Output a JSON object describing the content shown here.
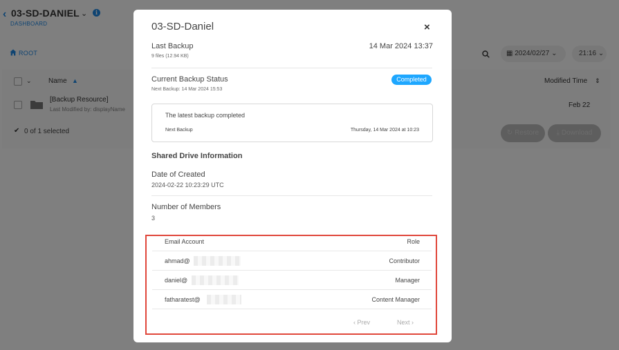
{
  "app": {
    "title": "03-SD-DANIEL",
    "subtitle": "DASHBOARD",
    "root_label": "ROOT",
    "date_filter": "2024/02/27",
    "time_filter": "21:16",
    "table": {
      "col_name": "Name",
      "col_modified": "Modified Time",
      "row": {
        "name": "[Backup Resource]",
        "meta": "Last Modified by: displayName",
        "date": "Feb 22"
      },
      "selected": "0 of 1 selected",
      "restore_label": "Restore",
      "download_label": "Download"
    }
  },
  "modal": {
    "title": "03-SD-Daniel",
    "close": "×",
    "last_backup": {
      "label": "Last Backup",
      "files": "9 files (12.94 KB)",
      "date": "14 Mar 2024 13:37"
    },
    "status": {
      "label": "Current Backup Status",
      "next": "Next Backup: 14 Mar 2024 15:53",
      "badge": "Completed"
    },
    "backup_box": {
      "message": "The latest backup completed",
      "next_label": "Next Backup",
      "next_value": "Thursday, 14 Mar 2024 at 10:23"
    },
    "shared_drive": {
      "heading": "Shared Drive Information",
      "created_label": "Date of Created",
      "created_value": "2024-02-22 10:23:29 UTC",
      "members_label": "Number of Members",
      "members_value": "3"
    },
    "members_table": {
      "col_email": "Email Account",
      "col_role": "Role",
      "rows": [
        {
          "email": "ahmad@",
          "role": "Contributor"
        },
        {
          "email": "daniel@",
          "role": "Manager"
        },
        {
          "email": "fatharatest@",
          "role": "Content Manager"
        }
      ],
      "prev": "Prev",
      "next": "Next"
    }
  },
  "colors": {
    "accent": "#1e88e5",
    "badge": "#1ea7ff",
    "highlight_border": "#e0463a"
  }
}
